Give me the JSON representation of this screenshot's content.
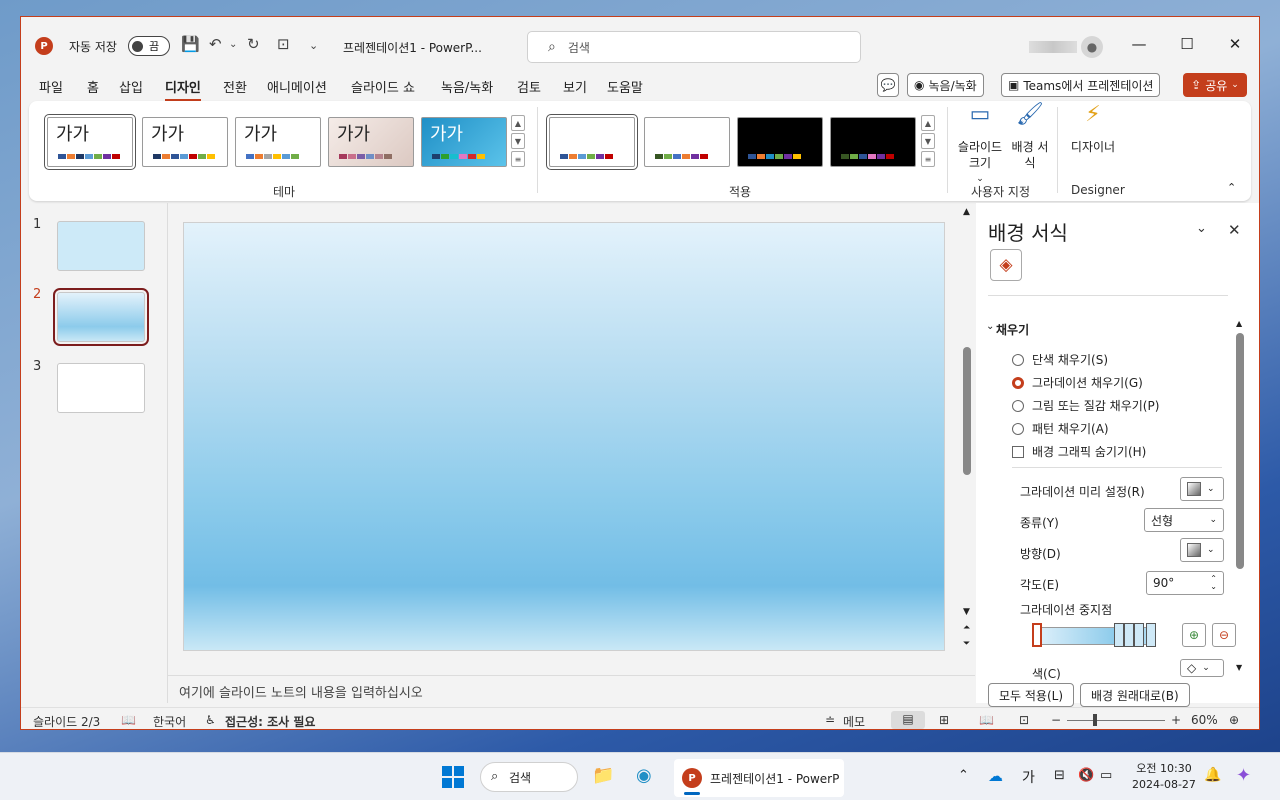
{
  "window": {
    "autosave_label": "자동 저장",
    "autosave_state": "끔",
    "doc_title": "프레젠테이션1  -  PowerP...",
    "search_placeholder": "검색"
  },
  "menu": {
    "tabs": [
      "파일",
      "홈",
      "삽입",
      "디자인",
      "전환",
      "애니메이션",
      "슬라이드 쇼",
      "녹음/녹화",
      "검토",
      "보기",
      "도움말"
    ],
    "active_tab": "디자인",
    "record_btn": "녹음/녹화",
    "teams_btn": "Teams에서 프레젠테이션",
    "share_btn": "공유"
  },
  "ribbon": {
    "theme_group_label": "테마",
    "theme_sample_text": "가가",
    "variant_group_label": "적용",
    "customize_group_label": "사용자 지정",
    "designer_group_label": "Designer",
    "slide_size": "슬라이드 크기",
    "format_background": "배경 서식",
    "designer": "디자이너"
  },
  "slides": {
    "numbers": [
      "1",
      "2",
      "3"
    ],
    "current": "2"
  },
  "notes_placeholder": "여기에 슬라이드 노트의 내용을 입력하십시오",
  "pane": {
    "title": "배경 서식",
    "section_fill": "채우기",
    "options": [
      "단색 채우기(S)",
      "그라데이션 채우기(G)",
      "그림 또는 질감 채우기(P)",
      "패턴 채우기(A)"
    ],
    "hide_graphics": "배경 그래픽 숨기기(H)",
    "preset_label": "그라데이션 미리 설정(R)",
    "type_label": "종류(Y)",
    "type_value": "선형",
    "direction_label": "방향(D)",
    "angle_label": "각도(E)",
    "angle_value": "90°",
    "stops_label": "그라데이션 중지점",
    "color_label": "색(C)",
    "apply_all": "모두 적용(L)",
    "reset": "배경 원래대로(B)"
  },
  "status": {
    "slide_counter": "슬라이드 2/3",
    "language": "한국어",
    "accessibility": "접근성: 조사 필요",
    "notes": "메모",
    "zoom": "60%"
  },
  "taskbar": {
    "search": "검색",
    "app_label": "프레젠테이션1 - PowerP",
    "ime": "가",
    "time": "오전 10:30",
    "date": "2024-08-27"
  },
  "colors": {
    "accent": "#c43e1c",
    "slide_dark": "#7c1d1d"
  }
}
